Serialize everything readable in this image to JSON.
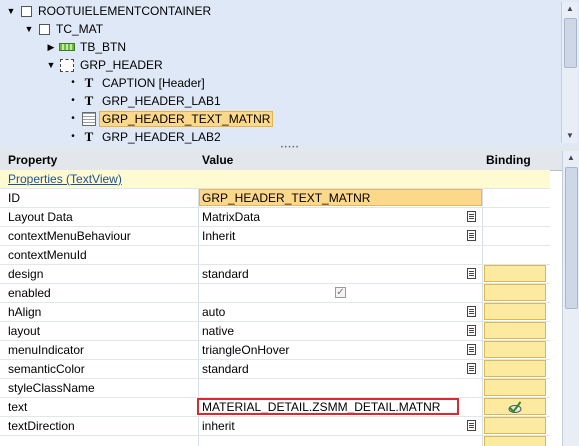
{
  "tree": {
    "nodes": [
      {
        "label": "ROOTUIELEMENTCONTAINER",
        "icon": "checkbox"
      },
      {
        "label": "TC_MAT",
        "icon": "checkbox"
      },
      {
        "label": "TB_BTN",
        "icon": "toolbar-button-icon"
      },
      {
        "label": "GRP_HEADER",
        "icon": "group-icon"
      },
      {
        "label": "CAPTION  [Header]",
        "icon": "text-T-icon"
      },
      {
        "label": "GRP_HEADER_LAB1",
        "icon": "text-T-icon"
      },
      {
        "label": "GRP_HEADER_TEXT_MATNR",
        "icon": "textview-icon"
      },
      {
        "label": "GRP_HEADER_LAB2",
        "icon": "text-T-icon"
      }
    ],
    "selected": "GRP_HEADER_TEXT_MATNR"
  },
  "grid": {
    "headers": {
      "property": "Property",
      "value": "Value",
      "binding": "Binding"
    },
    "section": "Properties (TextView)",
    "rows": [
      {
        "property": "ID",
        "value": "GRP_HEADER_TEXT_MATNR"
      },
      {
        "property": "Layout Data",
        "value": "MatrixData"
      },
      {
        "property": "contextMenuBehaviour",
        "value": "Inherit"
      },
      {
        "property": "contextMenuId",
        "value": ""
      },
      {
        "property": "design",
        "value": "standard"
      },
      {
        "property": "enabled",
        "value": "checked"
      },
      {
        "property": "hAlign",
        "value": "auto"
      },
      {
        "property": "layout",
        "value": "native"
      },
      {
        "property": "menuIndicator",
        "value": "triangleOnHover"
      },
      {
        "property": "semanticColor",
        "value": "standard"
      },
      {
        "property": "styleClassName",
        "value": ""
      },
      {
        "property": "text",
        "value": "MATERIAL_DETAIL.ZSMM_DETAIL.MATNR"
      },
      {
        "property": "textDirection",
        "value": "inherit"
      }
    ]
  },
  "colors": {
    "tree_bg": "#dfe8f6",
    "selection": "#fcd88a",
    "binding_cell": "#fdeaa1",
    "section_bg": "#fefbd2",
    "highlight_box": "#e0262e"
  }
}
